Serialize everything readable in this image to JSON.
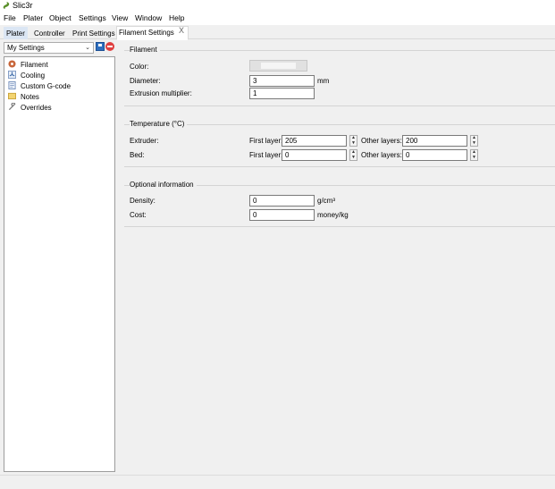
{
  "window": {
    "title": "Slic3r"
  },
  "menu": [
    "File",
    "Plater",
    "Object",
    "Settings",
    "View",
    "Window",
    "Help"
  ],
  "tabs": [
    {
      "label": "Plater"
    },
    {
      "label": "Controller"
    },
    {
      "label": "Print Settings"
    },
    {
      "label": "Filament Settings"
    }
  ],
  "tab_close": "X",
  "preset": {
    "selected": "My Settings",
    "chevron": "⌄"
  },
  "tree": [
    {
      "label": "Filament",
      "icon": "spool-icon"
    },
    {
      "label": "Cooling",
      "icon": "fan-icon"
    },
    {
      "label": "Custom G-code",
      "icon": "script-icon"
    },
    {
      "label": "Notes",
      "icon": "note-icon"
    },
    {
      "label": "Overrides",
      "icon": "wrench-icon"
    }
  ],
  "filament": {
    "title": "Filament",
    "color_label": "Color:",
    "diameter_label": "Diameter:",
    "diameter_value": "3",
    "diameter_unit": "mm",
    "multiplier_label": "Extrusion multiplier:",
    "multiplier_value": "1"
  },
  "temperature": {
    "title": "Temperature (°C)",
    "extruder_label": "Extruder:",
    "bed_label": "Bed:",
    "first_layer_label": "First layer:",
    "other_layers_label": "Other layers:",
    "extruder_first": "205",
    "extruder_other": "200",
    "bed_first": "0",
    "bed_other": "0"
  },
  "optional": {
    "title": "Optional information",
    "density_label": "Density:",
    "density_value": "0",
    "density_unit": "g/cm³",
    "cost_label": "Cost:",
    "cost_value": "0",
    "cost_unit": "money/kg"
  }
}
